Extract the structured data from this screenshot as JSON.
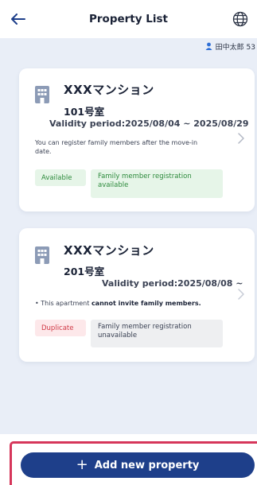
{
  "header": {
    "title": "Property List"
  },
  "user": {
    "name": "田中太郎 53"
  },
  "properties": [
    {
      "name": "XXXマンション",
      "room": "101号室",
      "validity": "Validity period:2025/08/04 ~ 2025/08/29",
      "note": "You can register family members after the move-in date.",
      "status": "Available",
      "family": "Family member registration available"
    },
    {
      "name": "XXXマンション",
      "room": "201号室",
      "validity": "Validity period:2025/08/08 ~",
      "note_prefix": "• This apartment ",
      "note_bold": "cannot invite family members.",
      "status": "Duplicate",
      "family": "Family member registration unavailable"
    }
  ],
  "footer": {
    "add_label": "Add new property"
  },
  "colors": {
    "primary": "#1e3f8a",
    "background": "#e9eef7",
    "available": "#2e8b3d",
    "duplicate": "#d03845",
    "highlight_frame": "#d6365a"
  }
}
